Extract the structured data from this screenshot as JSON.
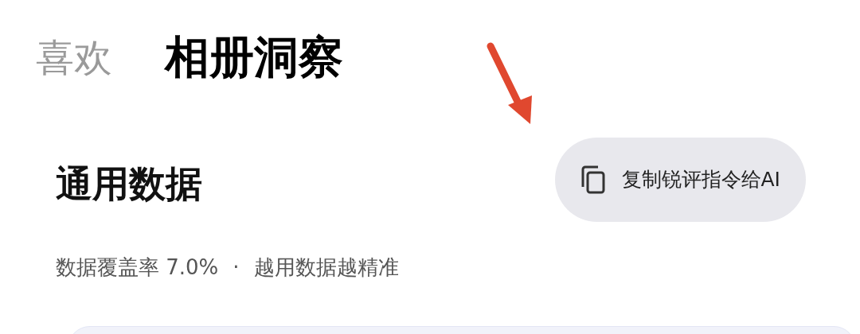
{
  "tabs": [
    {
      "label": "喜欢",
      "selected": false
    },
    {
      "label": "相册洞察",
      "selected": true
    }
  ],
  "section": {
    "title": "通用数据",
    "copy_button": "复制锐评指令给AI",
    "coverage": "数据覆盖率 7.0%",
    "separator": "·",
    "hint": "越用数据越精准"
  }
}
